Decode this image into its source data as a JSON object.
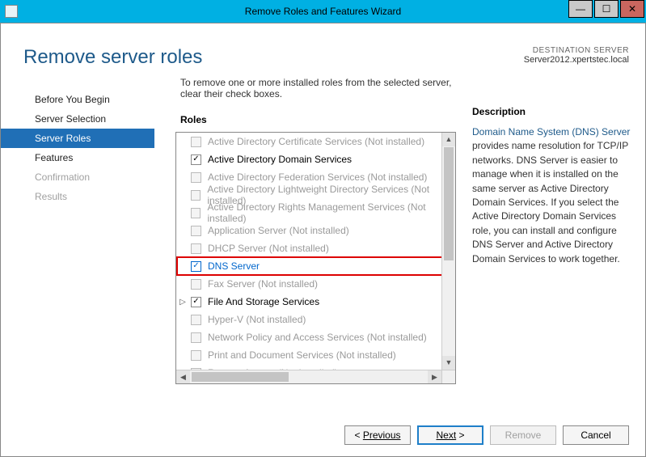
{
  "window": {
    "title": "Remove Roles and Features Wizard"
  },
  "header": {
    "page_title": "Remove server roles",
    "dest_label": "DESTINATION SERVER",
    "dest_server": "Server2012.xpertstec.local"
  },
  "nav": {
    "items": [
      {
        "label": "Before You Begin",
        "state": "normal"
      },
      {
        "label": "Server Selection",
        "state": "normal"
      },
      {
        "label": "Server Roles",
        "state": "selected"
      },
      {
        "label": "Features",
        "state": "normal"
      },
      {
        "label": "Confirmation",
        "state": "disabled"
      },
      {
        "label": "Results",
        "state": "disabled"
      }
    ]
  },
  "main": {
    "instruction": "To remove one or more installed roles from the selected server, clear their check boxes.",
    "roles_heading": "Roles",
    "roles": [
      {
        "label": "Active Directory Certificate Services (Not installed)",
        "checked": false,
        "enabled": false
      },
      {
        "label": "Active Directory Domain Services",
        "checked": true,
        "enabled": true
      },
      {
        "label": "Active Directory Federation Services (Not installed)",
        "checked": false,
        "enabled": false
      },
      {
        "label": "Active Directory Lightweight Directory Services (Not installed)",
        "checked": false,
        "enabled": false
      },
      {
        "label": "Active Directory Rights Management Services (Not installed)",
        "checked": false,
        "enabled": false
      },
      {
        "label": "Application Server (Not installed)",
        "checked": false,
        "enabled": false
      },
      {
        "label": "DHCP Server (Not installed)",
        "checked": false,
        "enabled": false
      },
      {
        "label": "DNS Server",
        "checked": true,
        "enabled": true,
        "highlighted": true
      },
      {
        "label": "Fax Server (Not installed)",
        "checked": false,
        "enabled": false
      },
      {
        "label": "File And Storage Services",
        "checked": true,
        "enabled": true,
        "expandable": true
      },
      {
        "label": "Hyper-V (Not installed)",
        "checked": false,
        "enabled": false
      },
      {
        "label": "Network Policy and Access Services (Not installed)",
        "checked": false,
        "enabled": false
      },
      {
        "label": "Print and Document Services (Not installed)",
        "checked": false,
        "enabled": false
      },
      {
        "label": "Remote Access (Not installed)",
        "checked": false,
        "enabled": false
      }
    ]
  },
  "description": {
    "heading": "Description",
    "title": "Domain Name System (DNS) Server",
    "body": " provides name resolution for TCP/IP networks. DNS Server is easier to manage when it is installed on the same server as Active Directory Domain Services. If you select the Active Directory Domain Services role, you can install and configure DNS Server and Active Directory Domain Services to work together."
  },
  "buttons": {
    "previous_prefix": "< ",
    "previous": "Previous",
    "next": "Next",
    "next_suffix": " >",
    "remove": "Remove",
    "cancel": "Cancel"
  }
}
